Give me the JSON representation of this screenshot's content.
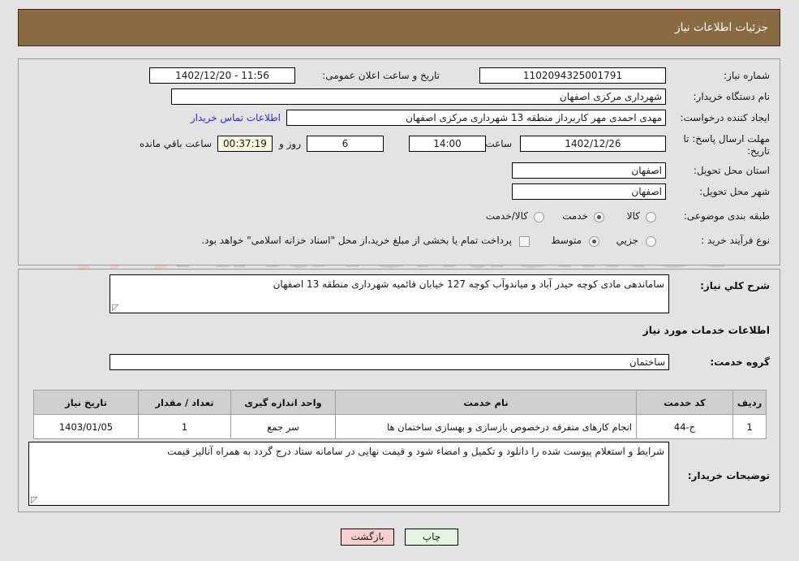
{
  "header": {
    "title": "جزئیات اطلاعات نیاز"
  },
  "watermark": {
    "text": "AriaTender.net"
  },
  "top": {
    "need_number_label": "شماره نیاز:",
    "need_number_value": "1102094325001791",
    "announce_label": "تاریخ و ساعت اعلان عمومی:",
    "announce_value": "11:56 - 1402/12/20",
    "buyer_org_label": "نام دستگاه خریدار:",
    "buyer_org_value": "شهرداری مرکزی اصفهان",
    "creator_label": "ایجاد کننده درخواست:",
    "creator_value": "مهدی احمدی مهر کاربرداز منطقه 13 شهرداری مرکزی اصفهان",
    "contact_link": "اطلاعات تماس خریدار",
    "deadline_label": "مهلت ارسال پاسخ: تا تاریخ:",
    "deadline_date": "1402/12/26",
    "hour_label": "ساعت",
    "hour_value": "14:00",
    "days_value": "6",
    "days_label": "روز و",
    "timer_value": "00:37:19",
    "timer_label": "ساعت باقي مانده",
    "province_label": "استان محل تحویل:",
    "province_value": "اصفهان",
    "city_label": "شهر محل تحویل:",
    "city_value": "اصفهان",
    "category_label": "طبقه بندی موضوعی:",
    "category_options": [
      "کالا",
      "خدمت",
      "کالا/خدمت"
    ],
    "category_selected": "خدمت",
    "process_label": "نوع فرآیند خرید :",
    "process_options": [
      "جزیي",
      "متوسط"
    ],
    "process_selected": "متوسط",
    "treasury_checked": false,
    "treasury_note": "پرداخت تمام یا بخشی از مبلغ خرید،از محل \"اسناد خزانه اسلامی\" خواهد بود."
  },
  "mid": {
    "summary_label": "شرح کلي نیاز:",
    "summary_value": "ساماندهی مادی کوچه حیدر آباد و میاندوآب کوچه 127 خیابان قائمیه شهرداری منطقه 13 اصفهان",
    "services_section_title": "اطلاعات خدمات مورد نیاز",
    "service_group_label": "گروه خدمت:",
    "service_group_value": "ساختمان",
    "table": {
      "columns": [
        "ردیف",
        "کد خدمت",
        "نام خدمت",
        "واحد اندازه گیری",
        "تعداد / مقدار",
        "تاریخ نیاز"
      ],
      "rows": [
        {
          "row": "1",
          "code": "ج-44",
          "name": "انجام کارهای متفرقه درخصوص بازسازی و بهسازی ساختمان ها",
          "unit": "سر جمع",
          "qty": "1",
          "date": "1403/01/05"
        }
      ]
    },
    "notes_label": "توضیحات خریدار:",
    "notes_value": "شرایط و استعلام پیوست شده را دانلود و تکمیل و امضاء شود و قیمت نهایی در سامانه ستاد درج گردد به همراه آنالیز قیمت"
  },
  "footer": {
    "back_label": "بازگشت",
    "print_label": "چاپ"
  },
  "colors": {
    "header_bg": "#8a6a41",
    "page_bg": "#e3e3e3",
    "link": "#2b2bcf",
    "timer_bg": "#fbf8e0",
    "back_btn": "#f9cfcf",
    "print_btn": "#e3f4e1",
    "table_head": "#cfcfcf"
  }
}
